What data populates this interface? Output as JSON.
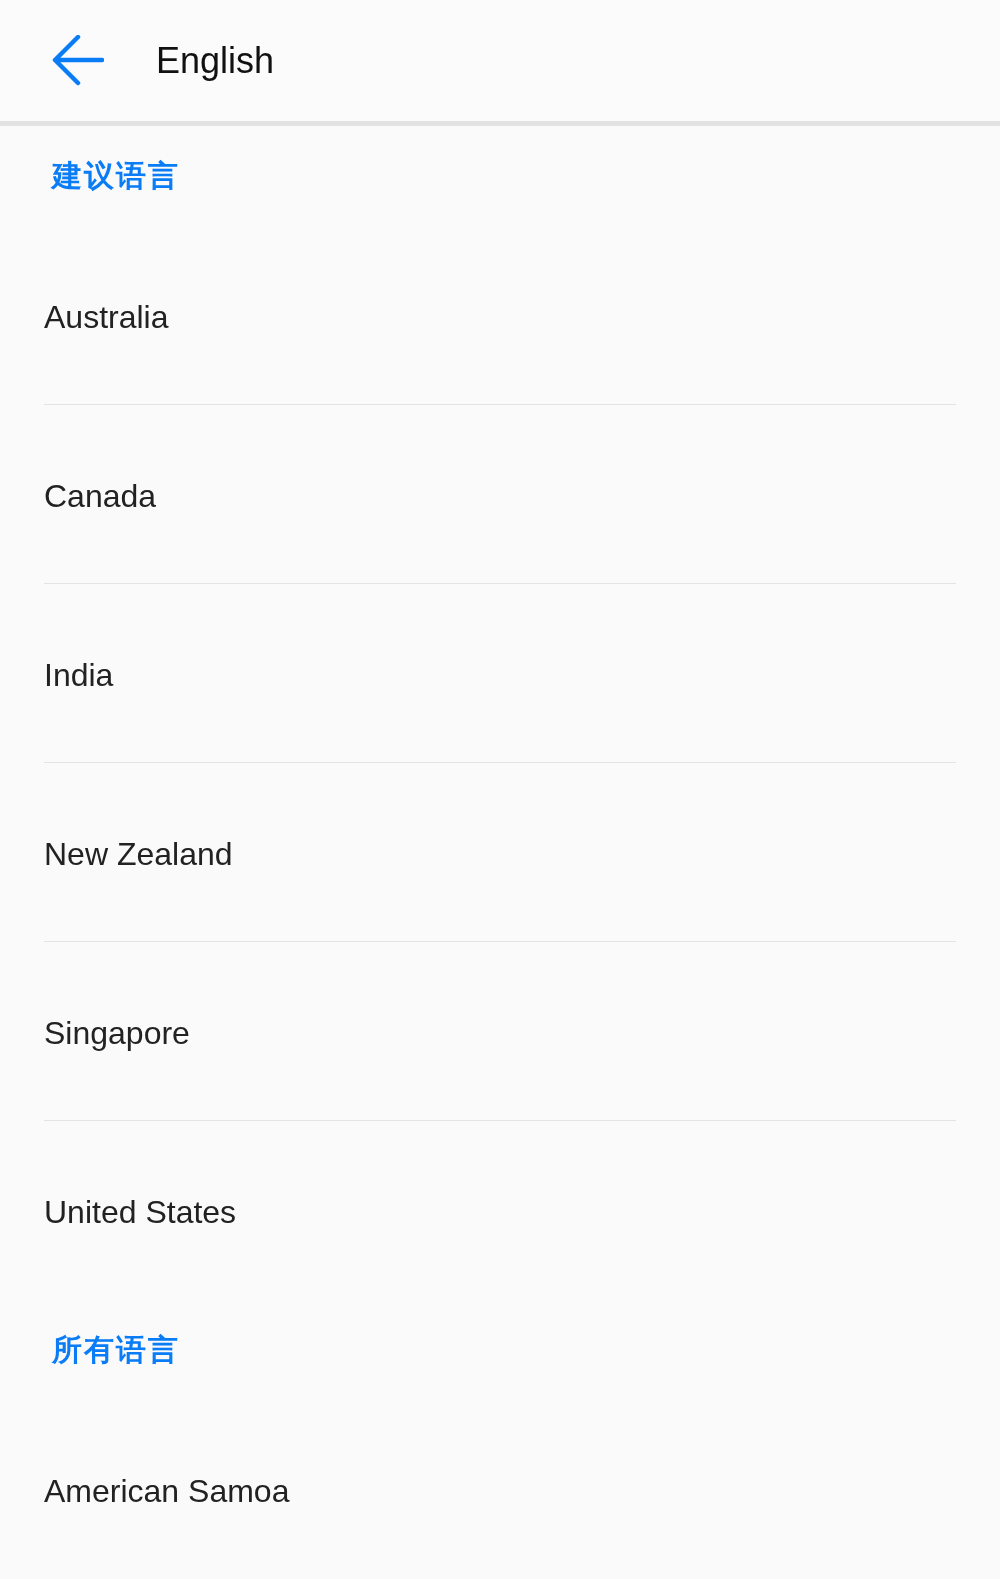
{
  "header": {
    "back_button": true,
    "title": "English"
  },
  "sections": [
    {
      "title": "建议语言",
      "items": [
        {
          "label": "Australia"
        },
        {
          "label": "Canada"
        },
        {
          "label": "India"
        },
        {
          "label": "New Zealand"
        },
        {
          "label": "Singapore"
        },
        {
          "label": "United States"
        }
      ]
    },
    {
      "title": "所有语言",
      "items": [
        {
          "label": "American Samoa"
        }
      ]
    }
  ]
}
